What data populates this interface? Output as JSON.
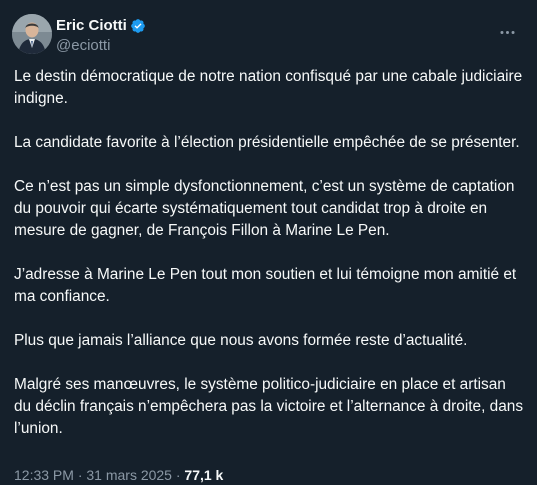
{
  "author": {
    "name": "Eric Ciotti",
    "handle": "@eciotti",
    "verified": true
  },
  "tweet": {
    "paragraphs": [
      "Le destin démocratique de notre nation confisqué par une cabale judiciaire indigne.",
      "La candidate favorite à l’élection présidentielle empêchée de se présenter.",
      "Ce n’est pas un simple dysfonctionnement, c’est un système de captation du pouvoir qui écarte systématiquement tout candidat trop à droite en mesure de gagner, de François Fillon à Marine Le Pen.",
      "J’adresse à Marine Le Pen tout mon soutien et lui témoigne mon amitié et ma confiance.",
      "Plus que jamais l’alliance que nous avons formée reste d’actualité.",
      "Malgré ses manœuvres, le système politico-judiciaire en place et artisan du déclin français n’empêchera pas la victoire et l’alternance à droite, dans l’union."
    ]
  },
  "footer": {
    "meta": "12:33 PM · 31 mars 2025 · ",
    "views": "77,1 k"
  },
  "colors": {
    "background": "#15202b",
    "text": "#f7f9f9",
    "secondary": "#8b98a5",
    "verified": "#1d9bf0"
  },
  "icons": {
    "verified": "verified-badge-icon",
    "more": "more-options-icon"
  }
}
